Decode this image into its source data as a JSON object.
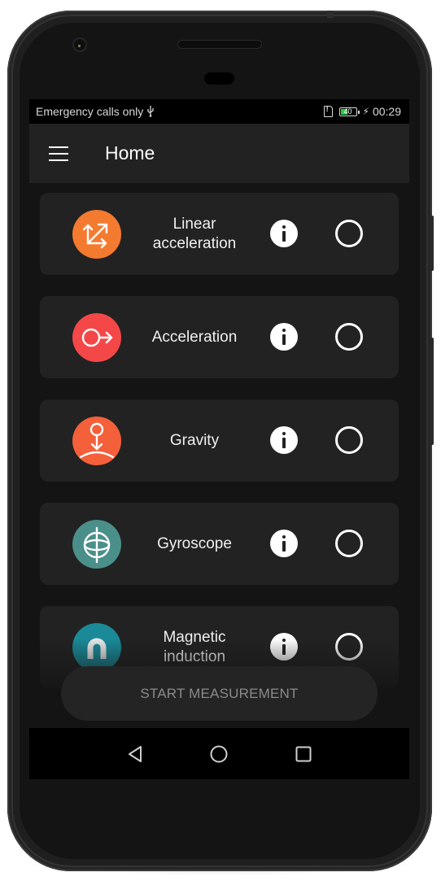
{
  "status_bar": {
    "carrier_text": "Emergency calls only",
    "usb_icon": "usb-icon",
    "sim_icon": "sim-alert-icon",
    "battery_level": "40",
    "battery_percent": 40,
    "charging_icon": "bolt-icon",
    "time": "00:29"
  },
  "app_bar": {
    "menu_icon": "hamburger-menu-icon",
    "title": "Home"
  },
  "sensors": [
    {
      "label": "Linear acceleration",
      "icon": "linear-acceleration-icon",
      "color": "#f47a30",
      "selected": false
    },
    {
      "label": "Acceleration",
      "icon": "acceleration-icon",
      "color": "#f44848",
      "selected": false
    },
    {
      "label": "Gravity",
      "icon": "gravity-icon",
      "color": "#f4603a",
      "selected": false
    },
    {
      "label": "Gyroscope",
      "icon": "gyroscope-icon",
      "color": "#4a8f8a",
      "selected": false
    },
    {
      "label": "Magnetic induction",
      "icon": "magnet-icon",
      "color": "#1a8a98",
      "selected": false
    }
  ],
  "actions": {
    "start_measurement": "START MEASUREMENT"
  },
  "nav_bar": {
    "back": "back-icon",
    "home": "home-icon",
    "recents": "recents-icon"
  },
  "colors": {
    "background": "#141414",
    "card": "#222222",
    "app_bar": "#222222",
    "battery_fill": "#2ecc40"
  }
}
